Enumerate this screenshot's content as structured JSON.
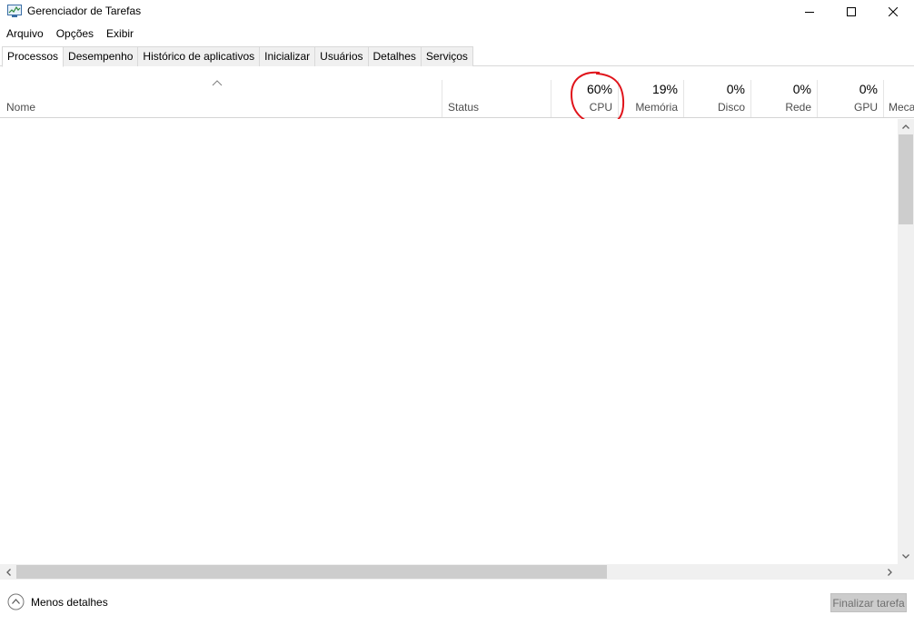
{
  "window": {
    "title": "Gerenciador de Tarefas"
  },
  "menu": [
    "Arquivo",
    "Opções",
    "Exibir"
  ],
  "tabs": [
    "Processos",
    "Desempenho",
    "Histórico de aplicativos",
    "Inicializar",
    "Usuários",
    "Detalhes",
    "Serviços"
  ],
  "active_tab": "Processos",
  "columns": {
    "name": "Nome",
    "status": "Status",
    "cpu": {
      "pct": "60%",
      "label": "CPU"
    },
    "memory": {
      "pct": "19%",
      "label": "Memória"
    },
    "disk": {
      "pct": "0%",
      "label": "Disco"
    },
    "network": {
      "pct": "0%",
      "label": "Rede"
    },
    "gpu": {
      "pct": "0%",
      "label": "GPU"
    },
    "gpu_engine": {
      "label": "Meca"
    }
  },
  "footer": {
    "less_details": "Menos detalhes",
    "end_task": "Finalizar tarefa"
  },
  "colors": {
    "annotation": "#e0141b",
    "disabled_button": "#cccccc"
  },
  "icons": [
    "task-manager-icon",
    "minimize-icon",
    "maximize-icon",
    "close-icon",
    "sort-up-icon",
    "chevron-up-circle-icon"
  ]
}
